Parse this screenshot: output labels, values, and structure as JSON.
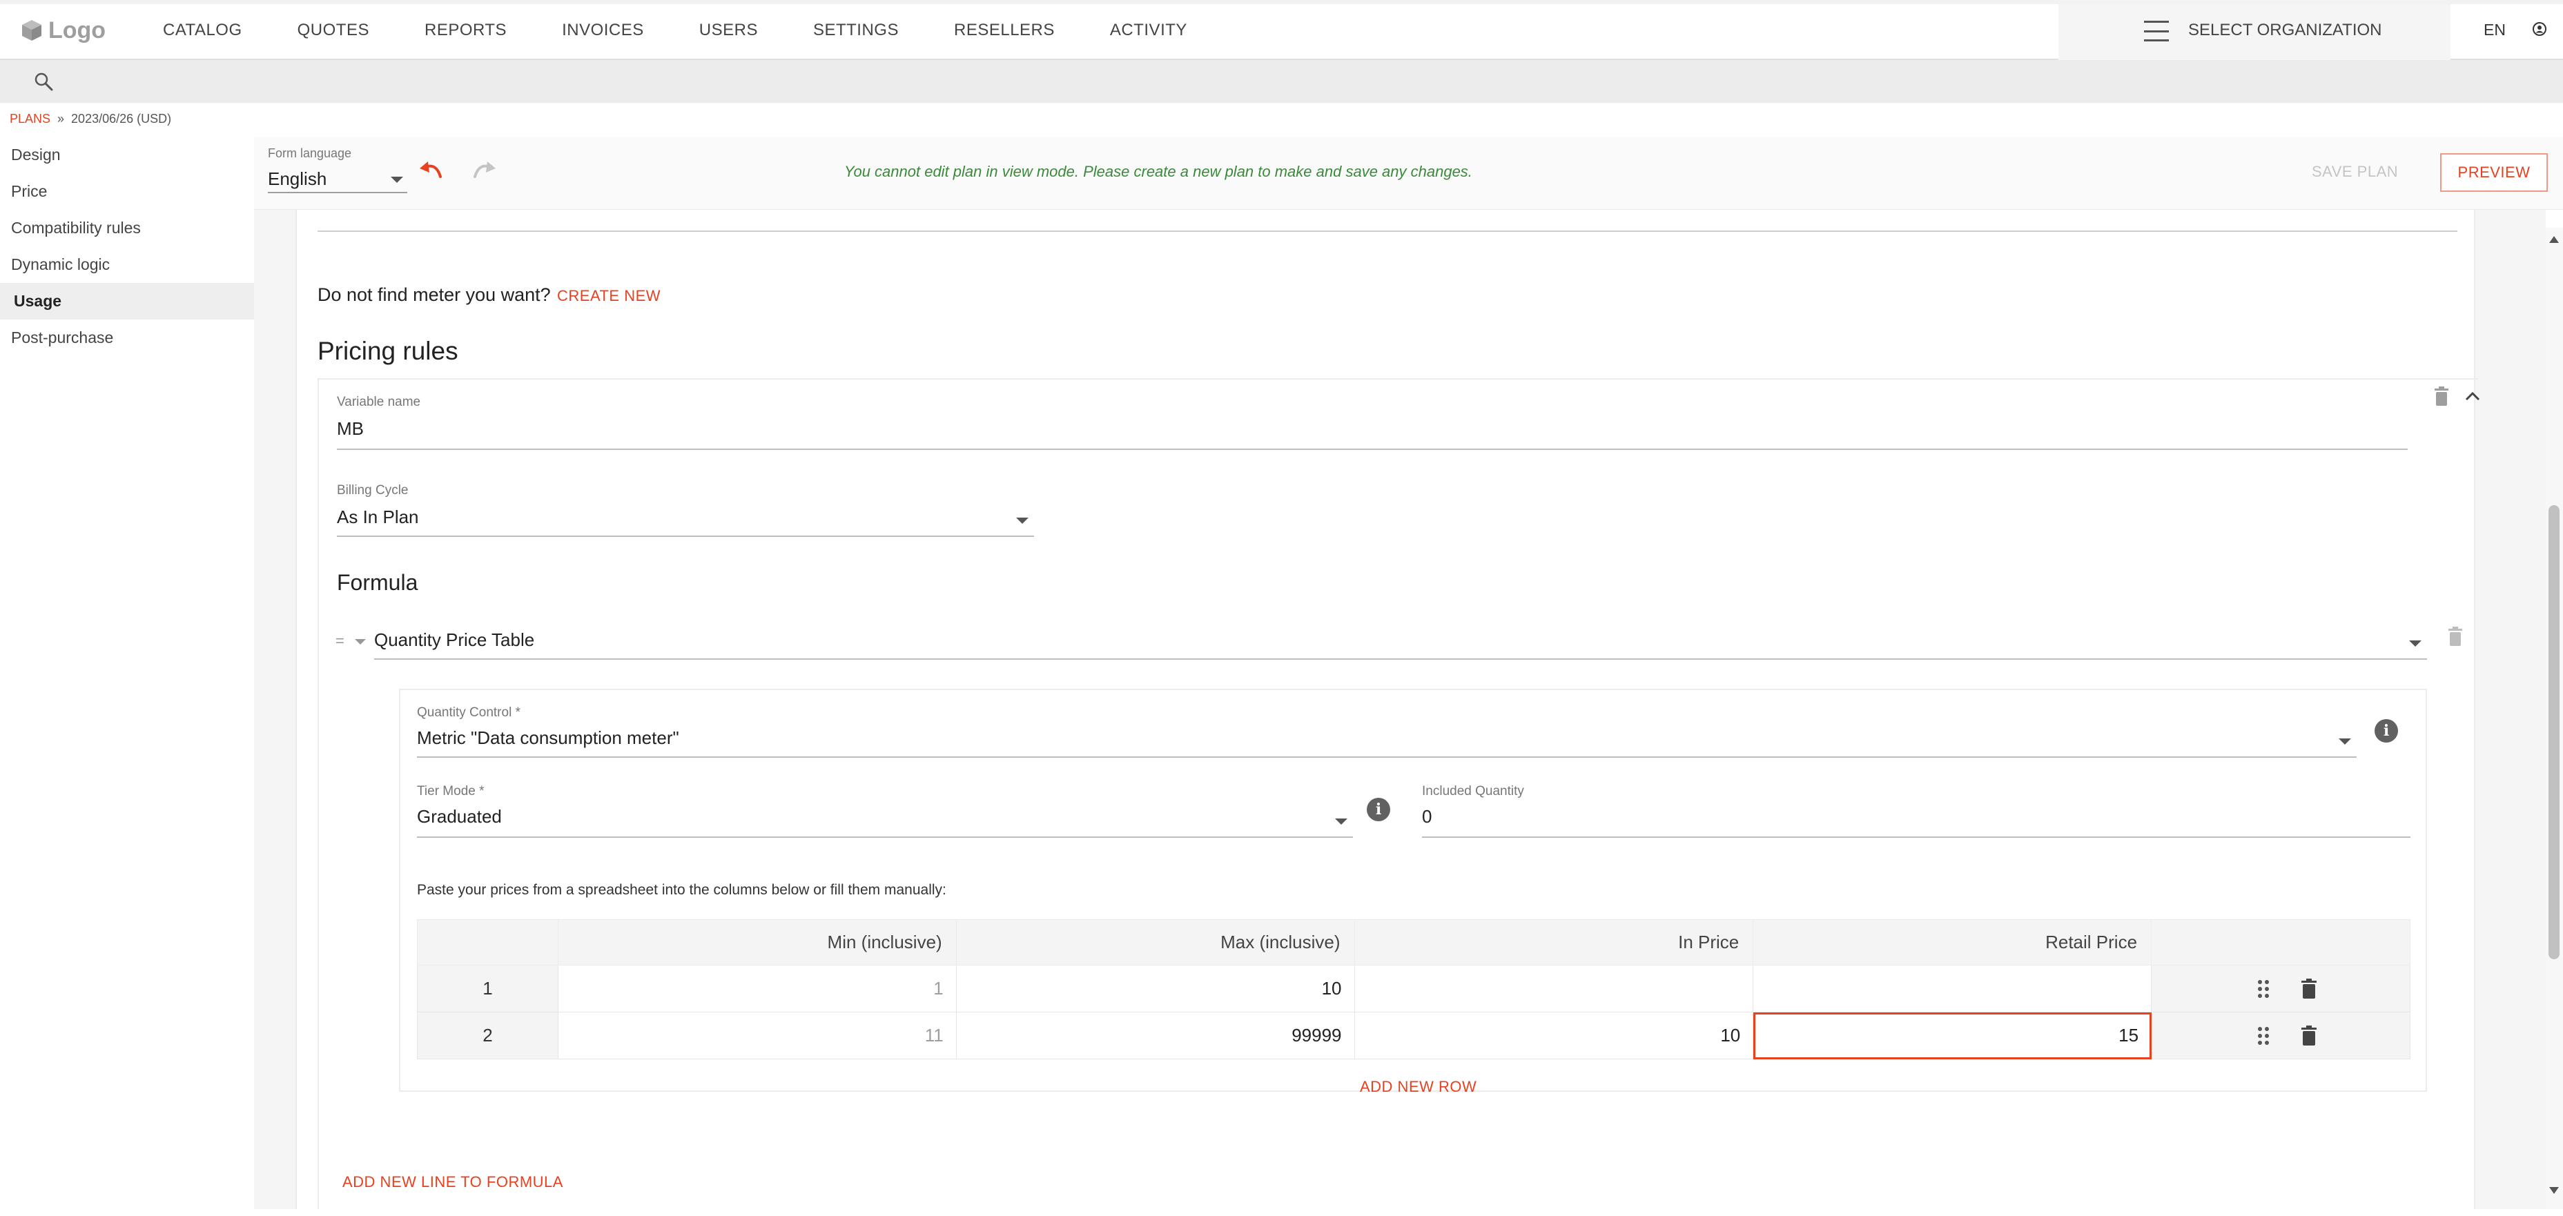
{
  "app": {
    "logo_text": "Logo",
    "accent_color": "#e8411f",
    "success_color": "#3a8a3a"
  },
  "nav": {
    "items": [
      "CATALOG",
      "QUOTES",
      "REPORTS",
      "INVOICES",
      "USERS",
      "SETTINGS",
      "RESELLERS",
      "ACTIVITY"
    ],
    "org_selector": "SELECT ORGANIZATION",
    "language": "EN"
  },
  "breadcrumb": {
    "root": "PLANS",
    "separator": "»",
    "current": "2023/06/26 (USD)"
  },
  "sidebar": {
    "items": [
      "Design",
      "Price",
      "Compatibility rules",
      "Dynamic logic",
      "Usage",
      "Post-purchase"
    ],
    "active": "Usage"
  },
  "toolbar": {
    "form_language_label": "Form language",
    "form_language_value": "English",
    "view_mode_message": "You cannot edit plan in view mode. Please create a new plan to make and save any changes.",
    "save_label": "SAVE PLAN",
    "preview_label": "PREVIEW"
  },
  "usage": {
    "meter_question": "Do not find meter you want?",
    "create_new_label": "CREATE NEW",
    "pricing_rules_title": "Pricing rules",
    "variable_name_label": "Variable name",
    "variable_name_value": "MB",
    "billing_cycle_label": "Billing Cycle",
    "billing_cycle_value": "As In Plan",
    "formula_title": "Formula",
    "formula_operator": "=",
    "formula_type": "Quantity Price Table",
    "quantity_control_label": "Quantity Control *",
    "quantity_control_value": "Metric \"Data consumption meter\"",
    "tier_mode_label": "Tier Mode *",
    "tier_mode_value": "Graduated",
    "included_quantity_label": "Included Quantity",
    "included_quantity_value": "0",
    "paste_note": "Paste your prices from a spreadsheet into the columns below or fill them manually:",
    "table": {
      "columns": [
        "",
        "Min (inclusive)",
        "Max (inclusive)",
        "In Price",
        "Retail Price",
        ""
      ],
      "rows": [
        {
          "index": "1",
          "min": "1",
          "max": "10",
          "in_price": "",
          "retail_price": ""
        },
        {
          "index": "2",
          "min": "11",
          "max": "99999",
          "in_price": "10",
          "retail_price": "15"
        }
      ]
    },
    "add_row_label": "ADD NEW ROW",
    "add_line_label": "ADD NEW LINE TO FORMULA"
  },
  "icons": {
    "logo": "cube-logo-icon",
    "menu": "hamburger-icon",
    "user": "user-circle-icon",
    "search": "search-icon",
    "undo": "undo-icon",
    "redo": "redo-icon",
    "delete": "trash-icon",
    "collapse": "chevron-up-icon",
    "info": "info-icon",
    "drag": "drag-handle-icon"
  }
}
